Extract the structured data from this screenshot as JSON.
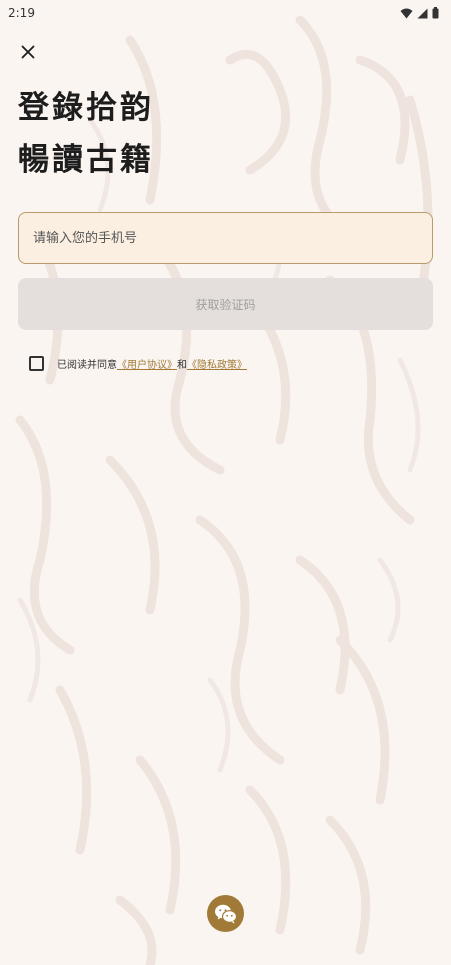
{
  "status": {
    "time": "2:19"
  },
  "header": {
    "title_line1": "登錄拾韵",
    "title_line2": "暢讀古籍"
  },
  "form": {
    "phone_placeholder": "请输入您的手机号",
    "phone_value": "",
    "code_button_label": "获取验证码"
  },
  "agreement": {
    "prefix": "已阅读并同意",
    "user_agreement": "《用户协议》",
    "and": "和",
    "privacy_policy": "《隐私政策》"
  },
  "colors": {
    "accent": "#a07a36",
    "background": "#fbf5f2",
    "field_bg": "#fbefe2"
  }
}
